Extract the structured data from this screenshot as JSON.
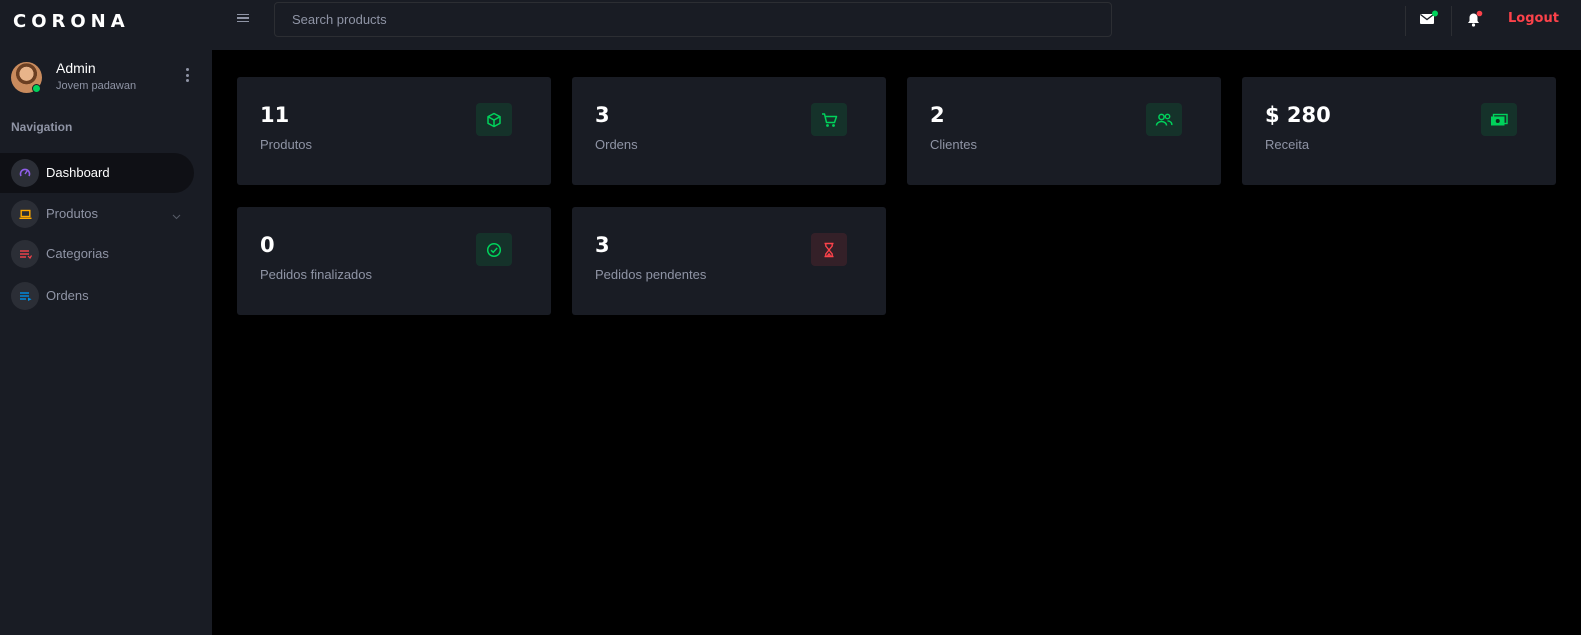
{
  "brand": {
    "name": "CORONA"
  },
  "profile": {
    "name": "Admin",
    "role": "Jovem padawan",
    "status_color": "#00d25b"
  },
  "sidebar": {
    "section_title": "Navigation",
    "items": [
      {
        "label": "Dashboard",
        "icon": "speedometer-icon",
        "icon_color": "#8f5fe8",
        "active": true
      },
      {
        "label": "Produtos",
        "icon": "laptop-icon",
        "icon_color": "#ffab00",
        "has_submenu": true
      },
      {
        "label": "Categorias",
        "icon": "playlist-icon",
        "icon_color": "#fc424a"
      },
      {
        "label": "Ordens",
        "icon": "list-icon",
        "icon_color": "#0090e7"
      }
    ]
  },
  "topbar": {
    "search_placeholder": "Search products",
    "logout_label": "Logout",
    "mail_badge_color": "#00d25b",
    "bell_badge_color": "#fc424a"
  },
  "cards": [
    {
      "value": "11",
      "label": "Produtos",
      "icon": "cube-icon",
      "tone": "green"
    },
    {
      "value": "3",
      "label": "Ordens",
      "icon": "cart-icon",
      "tone": "green"
    },
    {
      "value": "2",
      "label": "Clientes",
      "icon": "users-icon",
      "tone": "green"
    },
    {
      "value": "$ 280",
      "label": "Receita",
      "icon": "cash-icon",
      "tone": "green"
    },
    {
      "value": "0",
      "label": "Pedidos finalizados",
      "icon": "check-circle-icon",
      "tone": "green"
    },
    {
      "value": "3",
      "label": "Pedidos pendentes",
      "icon": "hourglass-icon",
      "tone": "red"
    }
  ],
  "colors": {
    "success": "#00d25b",
    "danger": "#fc424a",
    "panel": "#191c24",
    "muted": "#8f94a5"
  }
}
